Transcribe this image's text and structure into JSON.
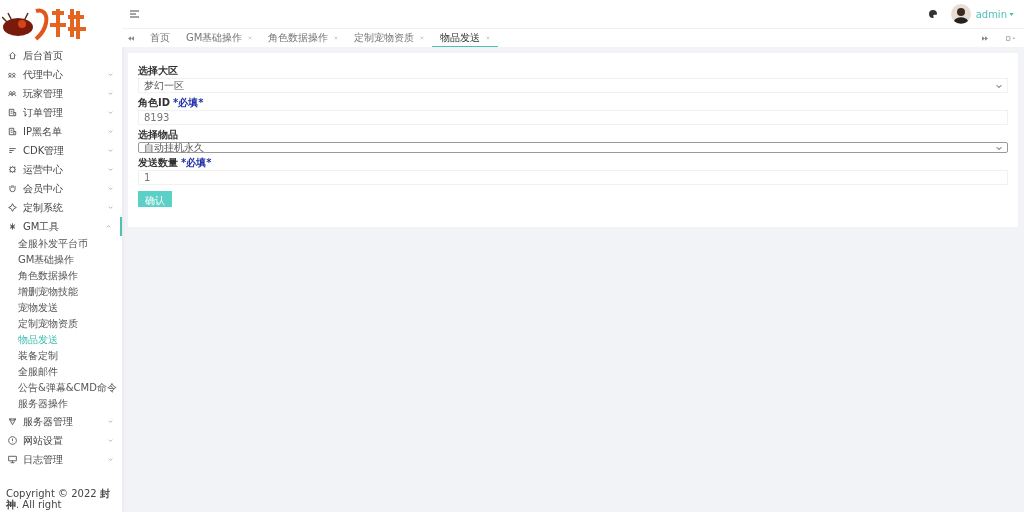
{
  "sidebar": {
    "items": [
      {
        "label": "后台首页"
      },
      {
        "label": "代理中心",
        "expanded": false
      },
      {
        "label": "玩家管理",
        "expanded": false
      },
      {
        "label": "订单管理",
        "expanded": false
      },
      {
        "label": "IP黑名单",
        "expanded": false
      },
      {
        "label": "CDK管理",
        "expanded": false
      },
      {
        "label": "运营中心",
        "expanded": false
      },
      {
        "label": "会员中心",
        "expanded": false
      },
      {
        "label": "定制系统",
        "expanded": false
      },
      {
        "label": "GM工具",
        "expanded": true,
        "children": [
          {
            "label": "全服补发平台币",
            "selected": false
          },
          {
            "label": "GM基础操作",
            "selected": false
          },
          {
            "label": "角色数据操作",
            "selected": false
          },
          {
            "label": "增删宠物技能",
            "selected": false
          },
          {
            "label": "宠物发送",
            "selected": false
          },
          {
            "label": "定制宠物资质",
            "selected": false
          },
          {
            "label": "物品发送",
            "selected": true
          },
          {
            "label": "装备定制",
            "selected": false
          },
          {
            "label": "全服邮件",
            "selected": false
          },
          {
            "label": "公告&弹幕&CMD命令",
            "selected": false
          },
          {
            "label": "服务器操作",
            "selected": false
          }
        ]
      },
      {
        "label": "服务器管理",
        "expanded": false
      },
      {
        "label": "网站设置",
        "expanded": false
      },
      {
        "label": "日志管理",
        "expanded": false
      }
    ],
    "copyright": "Copyright © 2022 **封神**. All right"
  },
  "header": {
    "user": "admin"
  },
  "tabs": [
    {
      "label": "首页",
      "selected": false,
      "closable": false
    },
    {
      "label": "GM基础操作",
      "selected": false,
      "closable": true
    },
    {
      "label": "角色数据操作",
      "selected": false,
      "closable": true
    },
    {
      "label": "定制宠物资质",
      "selected": false,
      "closable": true
    },
    {
      "label": "物品发送",
      "selected": true,
      "closable": true
    }
  ],
  "form": {
    "fields": [
      {
        "kind": "select",
        "label": "选择大区",
        "value": "梦幻一区",
        "focused": false
      },
      {
        "kind": "input",
        "label": "角色ID",
        "required_note": "*必填*",
        "value": "8193"
      },
      {
        "kind": "select",
        "label": "选择物品",
        "value": "自动挂机永久",
        "focused": true
      },
      {
        "kind": "input",
        "label": "发送数量",
        "required_note": "*必填*",
        "value": "1"
      }
    ],
    "submit": "确认"
  }
}
